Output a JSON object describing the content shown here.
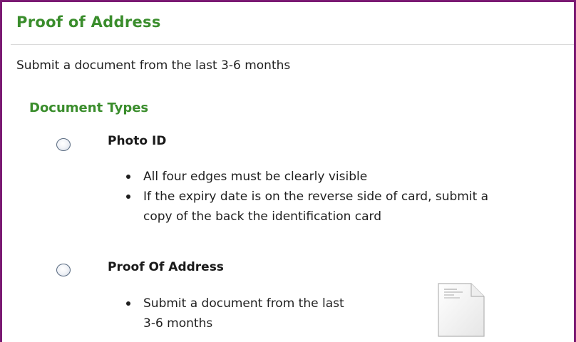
{
  "header": {
    "title": "Proof of Address"
  },
  "subtitle": "Submit a document from the last 3-6 months",
  "document_types": {
    "heading": "Document Types",
    "options": [
      {
        "label": "Photo ID",
        "bullets": [
          "All four edges must be clearly visible",
          "If the expiry date is on the reverse side of card, submit a",
          "copy of the back the identification card"
        ]
      },
      {
        "label": "Proof Of Address",
        "bullets": [
          "Submit a document from the last",
          "3-6 months"
        ]
      }
    ]
  },
  "icons": {
    "document": "document-icon"
  },
  "colors": {
    "accent_green": "#3a8d2c",
    "frame_border": "#7b1a73",
    "radio_border": "#5b6c82"
  }
}
